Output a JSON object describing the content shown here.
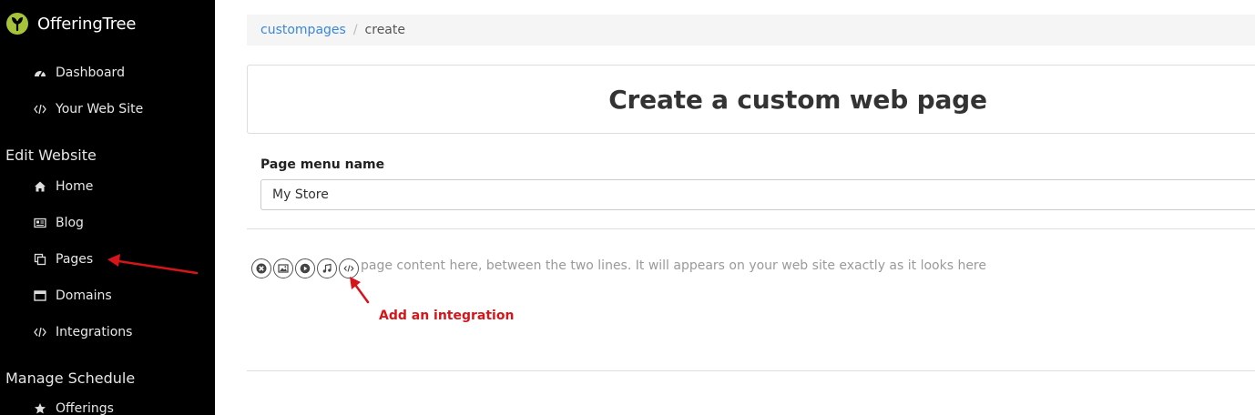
{
  "brand": {
    "name": "OfferingTree",
    "accent": "#a6c33a"
  },
  "sidebar": {
    "top_items": [
      {
        "label": "Dashboard",
        "icon": "dashboard-icon"
      },
      {
        "label": "Your Web Site",
        "icon": "code-icon"
      }
    ],
    "sections": [
      {
        "title": "Edit Website",
        "items": [
          {
            "label": "Home",
            "icon": "home-icon"
          },
          {
            "label": "Blog",
            "icon": "newspaper-icon"
          },
          {
            "label": "Pages",
            "icon": "pages-icon"
          },
          {
            "label": "Domains",
            "icon": "window-icon"
          },
          {
            "label": "Integrations",
            "icon": "code-icon"
          }
        ]
      },
      {
        "title": "Manage Schedule",
        "items": [
          {
            "label": "Offerings",
            "icon": "star-icon"
          }
        ]
      }
    ]
  },
  "breadcrumb": {
    "link": "custompages",
    "separator": "/",
    "current": "create"
  },
  "page": {
    "title": "Create a custom web page"
  },
  "form": {
    "menu_name_label": "Page menu name",
    "menu_name_value": "My Store"
  },
  "editor": {
    "placeholder": "page content here, between the two lines. It will appears on your web site exactly as it looks here",
    "toolbar": [
      "close-icon",
      "image-icon",
      "play-icon",
      "music-icon",
      "code-icon"
    ]
  },
  "annotation": {
    "text": "Add an integration",
    "color": "#d7141a"
  }
}
